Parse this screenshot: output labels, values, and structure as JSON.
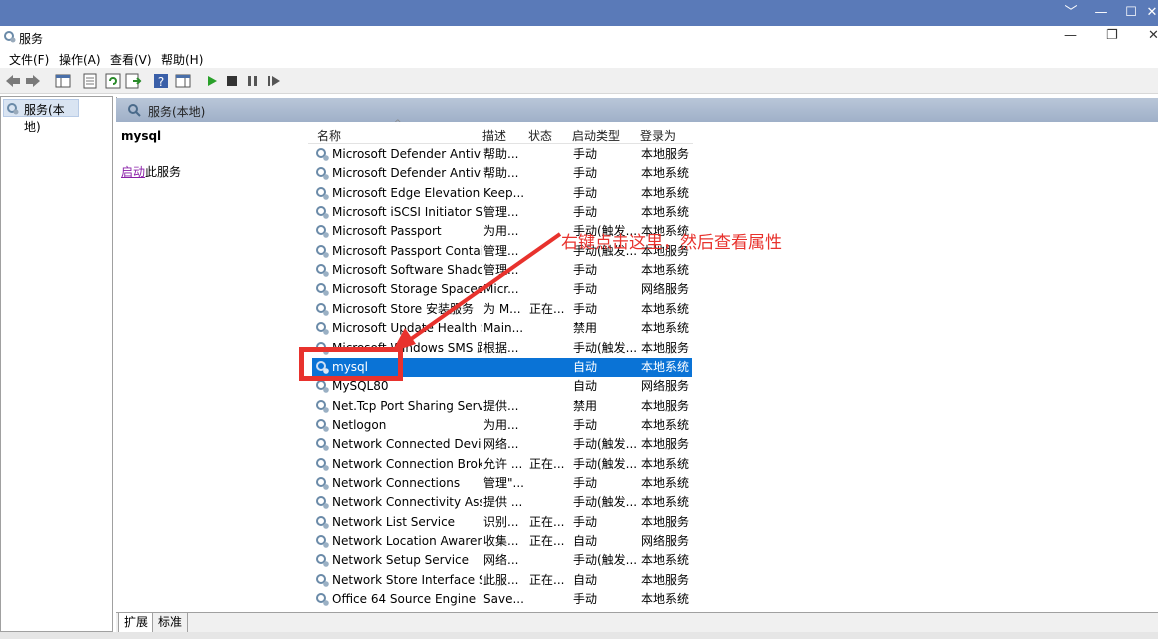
{
  "window": {
    "title": "服务",
    "minimize": "—",
    "restore": "❐",
    "close": "✕",
    "outer_chevron": "﹀",
    "outer_min": "—",
    "outer_max": "☐",
    "outer_close": "✕"
  },
  "menu": [
    "文件(F)",
    "操作(A)",
    "查看(V)",
    "帮助(H)"
  ],
  "tree": {
    "root": "服务(本地)"
  },
  "pane_header": "服务(本地)",
  "desc": {
    "service_name": "mysql",
    "link": "启动",
    "link_suffix": "此服务"
  },
  "columns": [
    "名称",
    "描述",
    "状态",
    "启动类型",
    "登录为"
  ],
  "services": [
    {
      "name": "Microsoft Defender Antivir...",
      "desc": "帮助...",
      "status": "",
      "startup": "手动",
      "logon": "本地服务"
    },
    {
      "name": "Microsoft Defender Antivir...",
      "desc": "帮助...",
      "status": "",
      "startup": "手动",
      "logon": "本地系统"
    },
    {
      "name": "Microsoft Edge Elevation S...",
      "desc": "Keep...",
      "status": "",
      "startup": "手动",
      "logon": "本地系统"
    },
    {
      "name": "Microsoft iSCSI Initiator Ser...",
      "desc": "管理...",
      "status": "",
      "startup": "手动",
      "logon": "本地系统"
    },
    {
      "name": "Microsoft Passport",
      "desc": "为用...",
      "status": "",
      "startup": "手动(触发...",
      "logon": "本地系统"
    },
    {
      "name": "Microsoft Passport Container",
      "desc": "管理...",
      "status": "",
      "startup": "手动(触发...",
      "logon": "本地服务"
    },
    {
      "name": "Microsoft Software Shado...",
      "desc": "管理...",
      "status": "",
      "startup": "手动",
      "logon": "本地系统"
    },
    {
      "name": "Microsoft Storage Spaces S...",
      "desc": "Micr...",
      "status": "",
      "startup": "手动",
      "logon": "网络服务"
    },
    {
      "name": "Microsoft Store 安装服务",
      "desc": "为 M...",
      "status": "正在...",
      "startup": "手动",
      "logon": "本地系统"
    },
    {
      "name": "Microsoft Update Health S...",
      "desc": "Main...",
      "status": "",
      "startup": "禁用",
      "logon": "本地系统"
    },
    {
      "name": "Microsoft Windows SMS 路...",
      "desc": "根据...",
      "status": "",
      "startup": "手动(触发...",
      "logon": "本地服务"
    },
    {
      "name": "mysql",
      "desc": "",
      "status": "",
      "startup": "自动",
      "logon": "本地系统"
    },
    {
      "name": "MySQL80",
      "desc": "",
      "status": "",
      "startup": "自动",
      "logon": "网络服务"
    },
    {
      "name": "Net.Tcp Port Sharing Service",
      "desc": "提供...",
      "status": "",
      "startup": "禁用",
      "logon": "本地服务"
    },
    {
      "name": "Netlogon",
      "desc": "为用...",
      "status": "",
      "startup": "手动",
      "logon": "本地系统"
    },
    {
      "name": "Network Connected Devic...",
      "desc": "网络...",
      "status": "",
      "startup": "手动(触发...",
      "logon": "本地服务"
    },
    {
      "name": "Network Connection Broker",
      "desc": "允许 ...",
      "status": "正在...",
      "startup": "手动(触发...",
      "logon": "本地系统"
    },
    {
      "name": "Network Connections",
      "desc": "管理\"...",
      "status": "",
      "startup": "手动",
      "logon": "本地系统"
    },
    {
      "name": "Network Connectivity Assis...",
      "desc": "提供 ...",
      "status": "",
      "startup": "手动(触发...",
      "logon": "本地系统"
    },
    {
      "name": "Network List Service",
      "desc": "识别...",
      "status": "正在...",
      "startup": "手动",
      "logon": "本地服务"
    },
    {
      "name": "Network Location Awarene...",
      "desc": "收集...",
      "status": "正在...",
      "startup": "自动",
      "logon": "网络服务"
    },
    {
      "name": "Network Setup Service",
      "desc": "网络...",
      "status": "",
      "startup": "手动(触发...",
      "logon": "本地系统"
    },
    {
      "name": "Network Store Interface Se...",
      "desc": "此服...",
      "status": "正在...",
      "startup": "自动",
      "logon": "本地服务"
    },
    {
      "name": "Office 64 Source Engine",
      "desc": "Save...",
      "status": "",
      "startup": "手动",
      "logon": "本地系统"
    }
  ],
  "annotation": {
    "text": "右键点击这里，然后查看属性",
    "color": "#e8322d"
  },
  "tabs": [
    "扩展",
    "标准"
  ],
  "colors": {
    "selection": "#0a73d6",
    "annotation": "#e8322d",
    "titlebar": "#5a7ab8"
  }
}
